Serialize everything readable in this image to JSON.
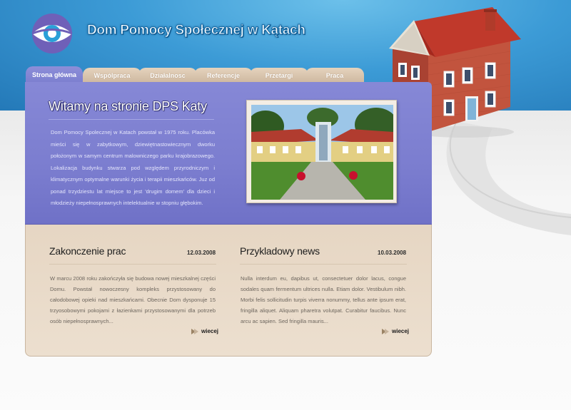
{
  "header": {
    "site_title": "Dom Pomocy Społecznej w Kątach",
    "logo_icon": "circular-eye-logo-icon"
  },
  "nav": {
    "tabs": [
      {
        "label": "Strona główna",
        "active": true
      },
      {
        "label": "Wspólpraca",
        "active": false
      },
      {
        "label": "Działalnosc",
        "active": false
      },
      {
        "label": "Referencje",
        "active": false
      },
      {
        "label": "Przetargi",
        "active": false
      },
      {
        "label": "Praca",
        "active": false
      }
    ]
  },
  "welcome": {
    "title": "Witamy na stronie DPS Katy",
    "text": "Dom Pomocy Spolecznej w Katach powstał w 1975 roku. Placówka mieści się w zabytkowym, dziewiętnastowiecznym dworku położonym w samym centrum malowniczego parku krajobrazowego. Lokalizacja budynku stwarza pod względem przyrodniczym i klimatycznym optymalne warunki życia i terapii mieszkańców. Juz od ponad trzydziestu lat miejsce to jest 'drugim domem' dla dzieci i młodzieży niepełnosprawnych intelektualnie w stopniu głębokim."
  },
  "news": [
    {
      "title": "Zakonczenie prac",
      "date": "12.03.2008",
      "body": "W marcu 2008 roku zakończyła się budowa nowej mieszkalnej części Domu. Powstał nowoczesny kompleks przystosowany do całodobowej opieki nad mieszkańcami. Obecnie Dom dysponuje 15 trzyosobowymi pokojami z łazienkami przystosowanymi dla potrzeb osób niepełnosprawnych...",
      "more": "wiecej"
    },
    {
      "title": "Przykladowy news",
      "date": "10.03.2008",
      "body": "Nulla interdum eu, dapibus ut, consectetuer dolor lacus, congue sodales quam fermentum ultrices nulla. Etiam dolor. Vestibulum nibh. Morbi felis sollicitudin turpis viverra nonummy, tellus ante ipsum erat, fringilla aliquet. Aliquam pharetra volutpat. Curabitur faucibus. Nunc arcu ac sapien. Sed fringilla mauris...",
      "more": "wiecej"
    }
  ],
  "colors": {
    "sky": "#3c9bd6",
    "panel_purple": "#7b7dcf",
    "panel_beige": "#e6d6c3",
    "tab_beige": "#d9c5ad"
  }
}
